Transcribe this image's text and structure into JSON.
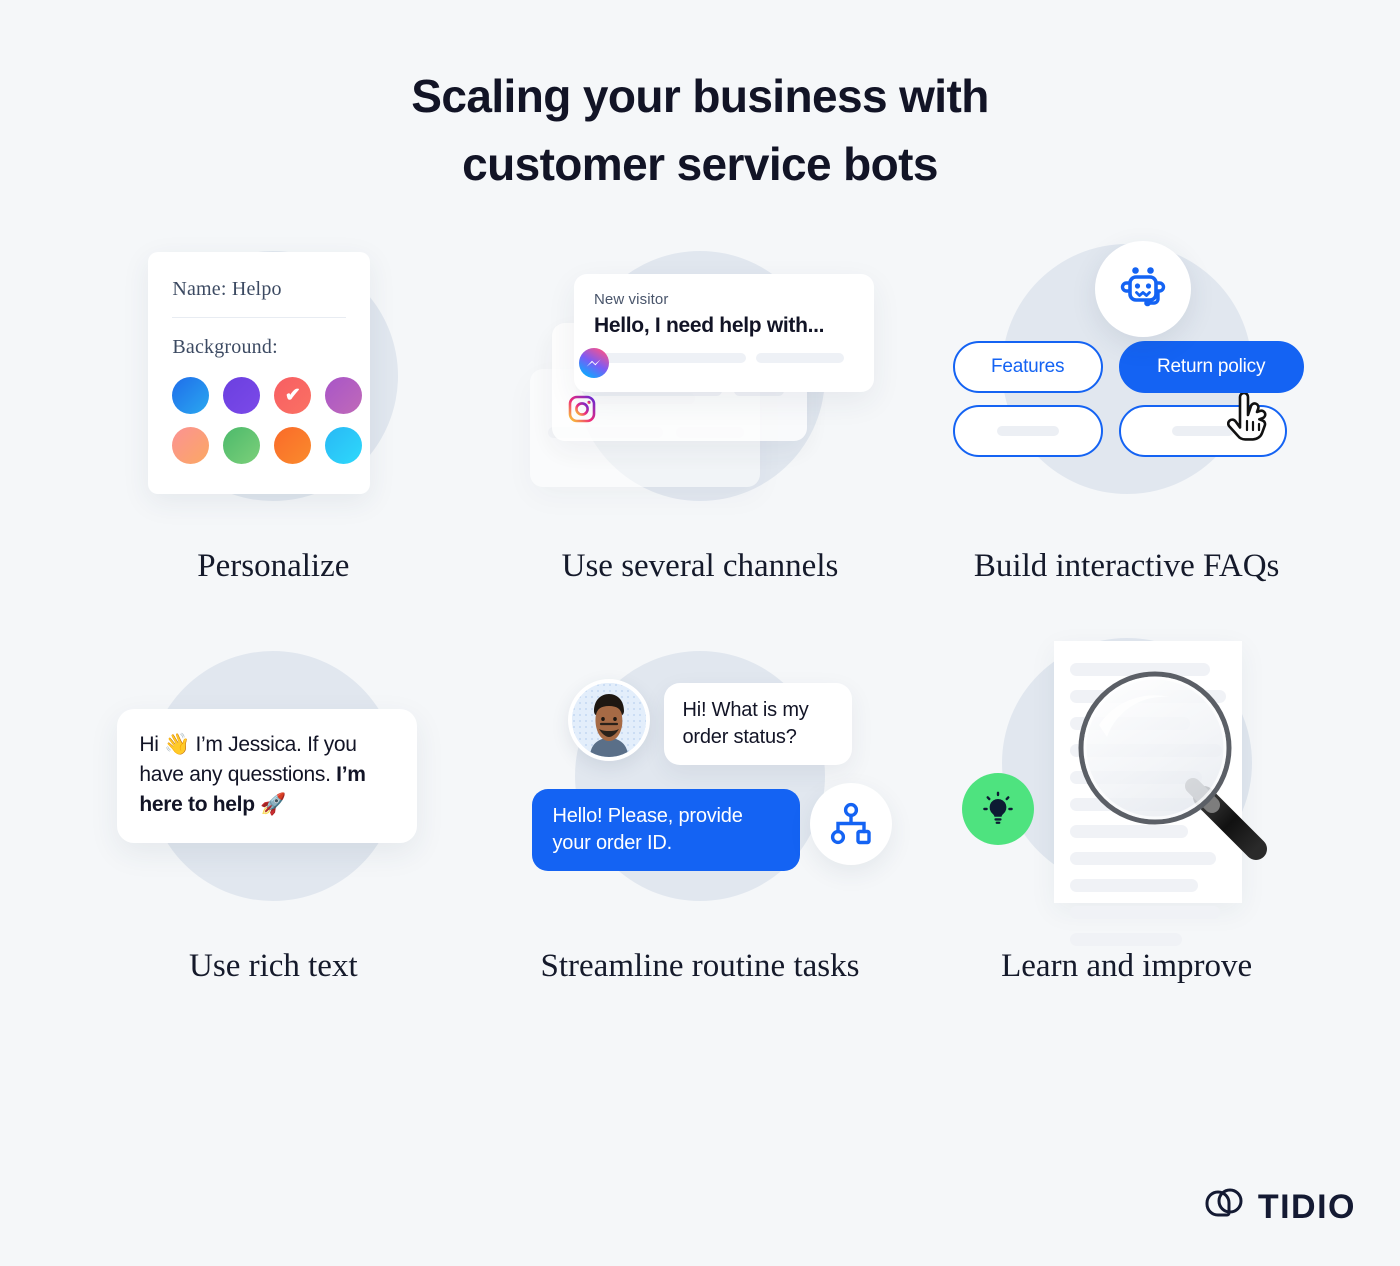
{
  "title": {
    "line1": "Scaling your business with",
    "line2": "customer service bots"
  },
  "colors": {
    "page_bg": "#f5f7f9",
    "blob": "#e1e7ef",
    "accent_blue": "#1463f3",
    "green": "#4ee37f",
    "ink": "#121426",
    "serif_ink": "#3c4a62"
  },
  "cards": [
    {
      "id": "personalize",
      "caption": "Personalize",
      "name_label": "Name: Helpo",
      "background_label": "Background:",
      "swatches": [
        {
          "name": "swatch-blue",
          "from": "#1f6dea",
          "to": "#2aa8f0",
          "selected": false
        },
        {
          "name": "swatch-purple",
          "from": "#6b3fe0",
          "to": "#7b4ae8",
          "selected": false
        },
        {
          "name": "swatch-red",
          "from": "#f85e63",
          "to": "#fa7163",
          "selected": true
        },
        {
          "name": "swatch-magenta",
          "from": "#a855c8",
          "to": "#c06ab8",
          "selected": false
        },
        {
          "name": "swatch-peach",
          "from": "#fb9293",
          "to": "#fba863",
          "selected": false
        },
        {
          "name": "swatch-green",
          "from": "#4cb96b",
          "to": "#7cd07a",
          "selected": false
        },
        {
          "name": "swatch-orange",
          "from": "#f96a2a",
          "to": "#fb8b2c",
          "selected": false
        },
        {
          "name": "swatch-cyan",
          "from": "#29b8f5",
          "to": "#2ed9fb",
          "selected": false
        }
      ],
      "selected_glyph": "✔"
    },
    {
      "id": "channels",
      "caption": "Use several channels",
      "note_label": "New visitor",
      "note_message": "Hello, I need help with...",
      "channel_icons": [
        "messenger-icon",
        "instagram-icon"
      ]
    },
    {
      "id": "faqs",
      "caption": "Build interactive FAQs",
      "bot_icon": "chatbot-headset-icon",
      "buttons": [
        {
          "label": "Features",
          "style": "outline"
        },
        {
          "label": "Return policy",
          "style": "filled"
        }
      ],
      "cursor_icon": "hand-pointer-cursor"
    },
    {
      "id": "rich-text",
      "caption": "Use rich text",
      "message_part1": "Hi ",
      "wave_emoji": "👋",
      "message_part2": " I’m Jessica. If you have any quesstions. ",
      "message_bold": "I’m here to help ",
      "rocket_emoji": "🚀"
    },
    {
      "id": "routine",
      "caption": "Streamline routine tasks",
      "avatar_name": "customer-avatar",
      "incoming_message": "Hi! What is my order status?",
      "outgoing_message": "Hello! Please, provide your order ID.",
      "flow_icon": "flowchart-nodes-icon"
    },
    {
      "id": "learn",
      "caption": "Learn and improve",
      "bulb_icon": "lightbulb-icon",
      "magnifier_icon": "magnifying-glass-icon",
      "document_icon": "document-lines"
    }
  ],
  "logo": {
    "mark": "tidio-logo-mark",
    "word": "TIDIO"
  }
}
